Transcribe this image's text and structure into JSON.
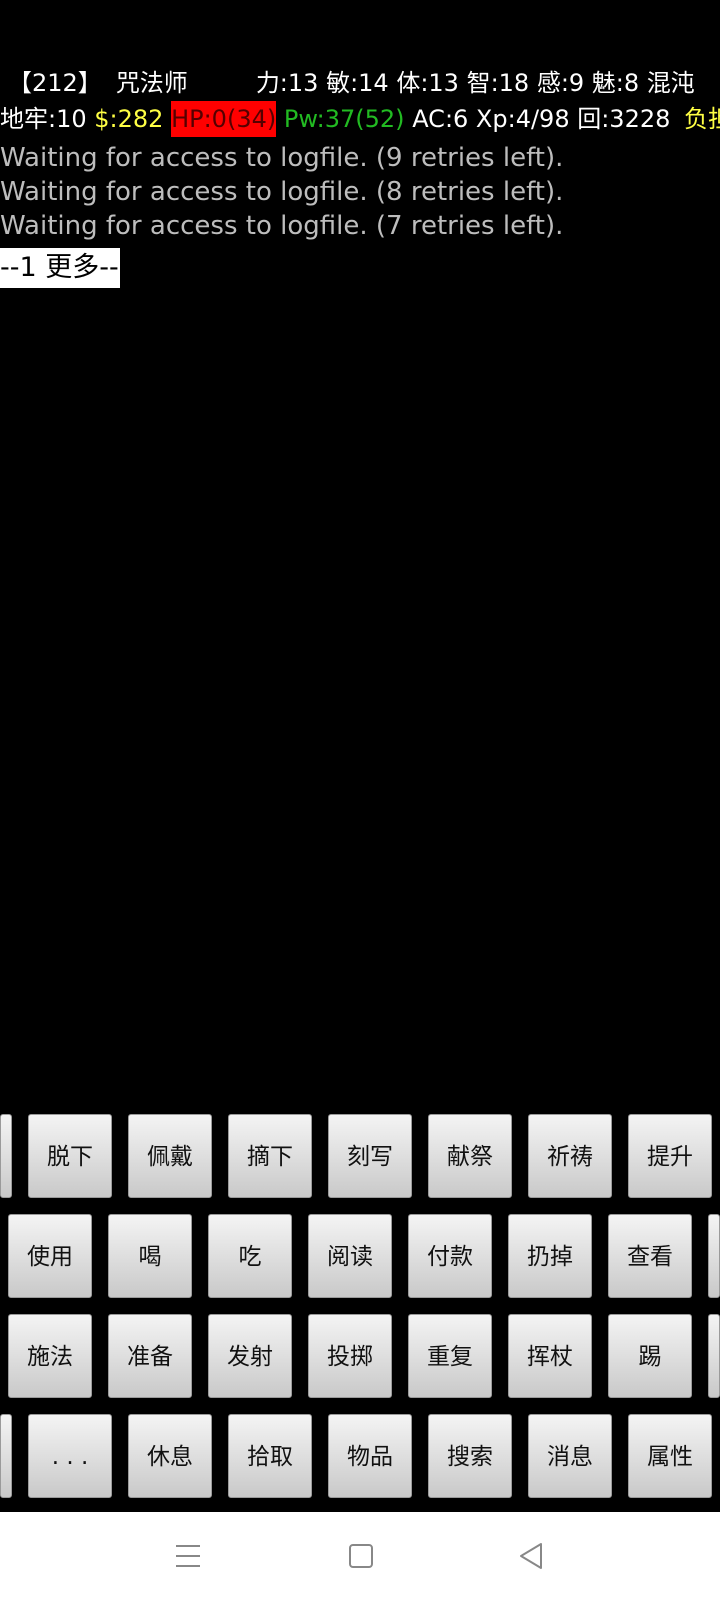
{
  "status_line_1": {
    "dungeon_level_tag": "【212】",
    "role": "咒法师",
    "attributes": "力:13 敏:14 体:13 智:18 感:9 魅:8 混沌"
  },
  "status_line_2": {
    "dungeon": "地牢:10",
    "gold": "$:282",
    "hp": "HP:0(34)",
    "pw": "Pw:37(52)",
    "stats": "AC:6 Xp:4/98 回:3228",
    "burden": "负担",
    "colors": {
      "gold": "#ffff44",
      "hp_background": "#ff0000",
      "pw": "#22bb22",
      "burden": "#ffff44"
    }
  },
  "messages": [
    "Waiting for access to logfile.  (9 retries left).",
    "Waiting for access to logfile.  (8 retries left).",
    "Waiting for access to logfile.  (7 retries left)."
  ],
  "more_prompt": "--1 更多--",
  "keyboard": {
    "row0": [
      "脱下",
      "佩戴",
      "摘下",
      "刻写",
      "献祭",
      "祈祷",
      "提升"
    ],
    "row1": [
      "使用",
      "喝",
      "吃",
      "阅读",
      "付款",
      "扔掉",
      "查看"
    ],
    "row2": [
      "施法",
      "准备",
      "发射",
      "投掷",
      "重复",
      "挥杖",
      "踢"
    ],
    "row3": [
      ". . .",
      "休息",
      "拾取",
      "物品",
      "搜索",
      "消息",
      "属性"
    ]
  },
  "navbar": {
    "icons": [
      "menu-icon",
      "home-icon",
      "back-icon"
    ]
  }
}
